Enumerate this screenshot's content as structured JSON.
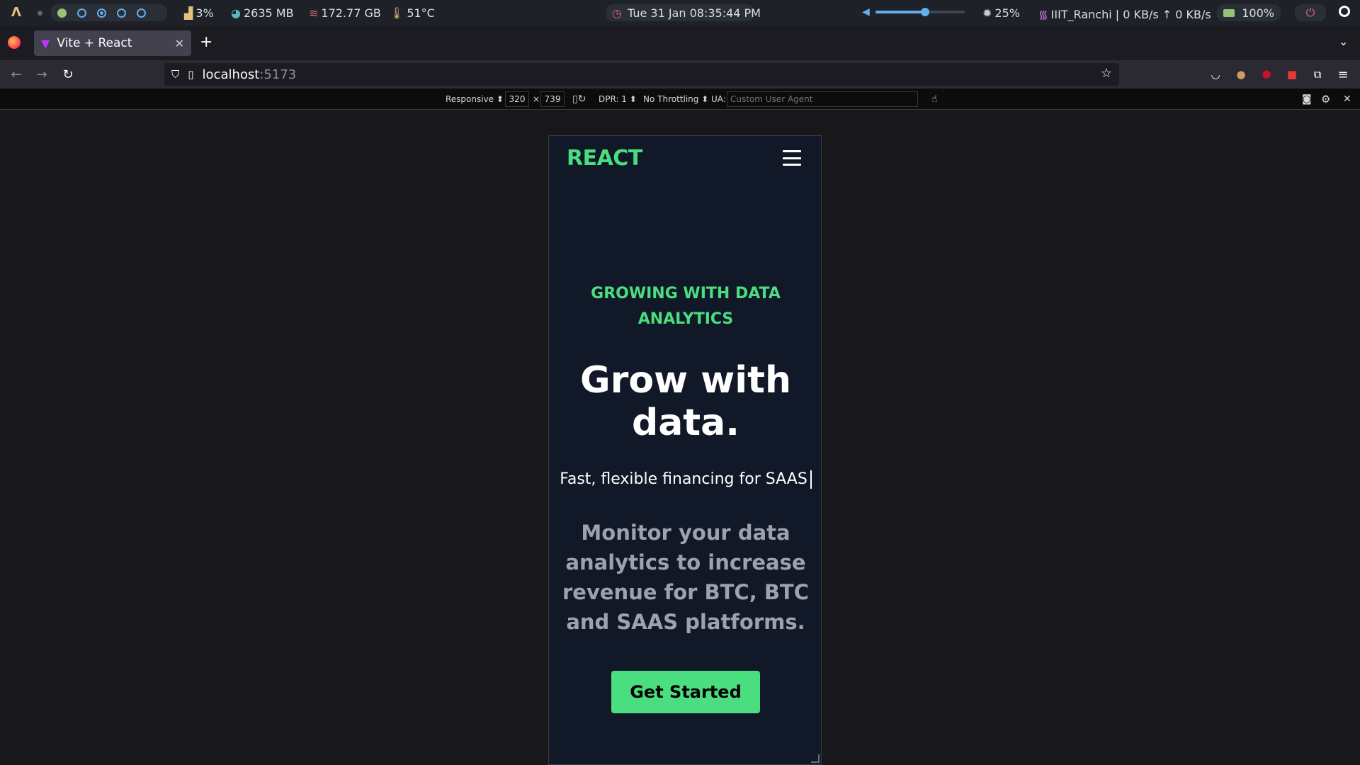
{
  "system_bar": {
    "workspaces": [
      "filled",
      "empty",
      "active",
      "empty",
      "empty"
    ],
    "cpu": "3%",
    "memory": "2635 MB",
    "disk": "172.77 GB",
    "temperature": "51°C",
    "clock": "Tue 31 Jan 08:35:44 PM",
    "volume_level": 0.56,
    "brightness": "25%",
    "network": "IIIT_Ranchi | 0 KB/s ↑ 0 KB/s ↓",
    "battery": "100%"
  },
  "browser": {
    "tab_title": "Vite + React",
    "new_tab_label": "+",
    "url_host": "localhost",
    "url_port": ":5173"
  },
  "responsive_toolbar": {
    "device": "Responsive ⬍",
    "width": "320",
    "times": "×",
    "height": "739",
    "dpr": "DPR: 1 ⬍",
    "throttling": "No Throttling ⬍",
    "ua_label": "UA:",
    "ua_placeholder": "Custom User Agent"
  },
  "page": {
    "logo": "REACT",
    "eyebrow": "GROWING WITH DATA ANALYTICS",
    "headline": "Grow with data.",
    "typed_text": "Fast, flexible financing for SAAS",
    "description": "Monitor your data analytics to increase revenue for BTC, BTC and SAAS platforms.",
    "cta_label": "Get Started"
  },
  "colors": {
    "accent": "#4ade80",
    "page_bg": "#111827",
    "muted_text": "#9ca3af"
  }
}
